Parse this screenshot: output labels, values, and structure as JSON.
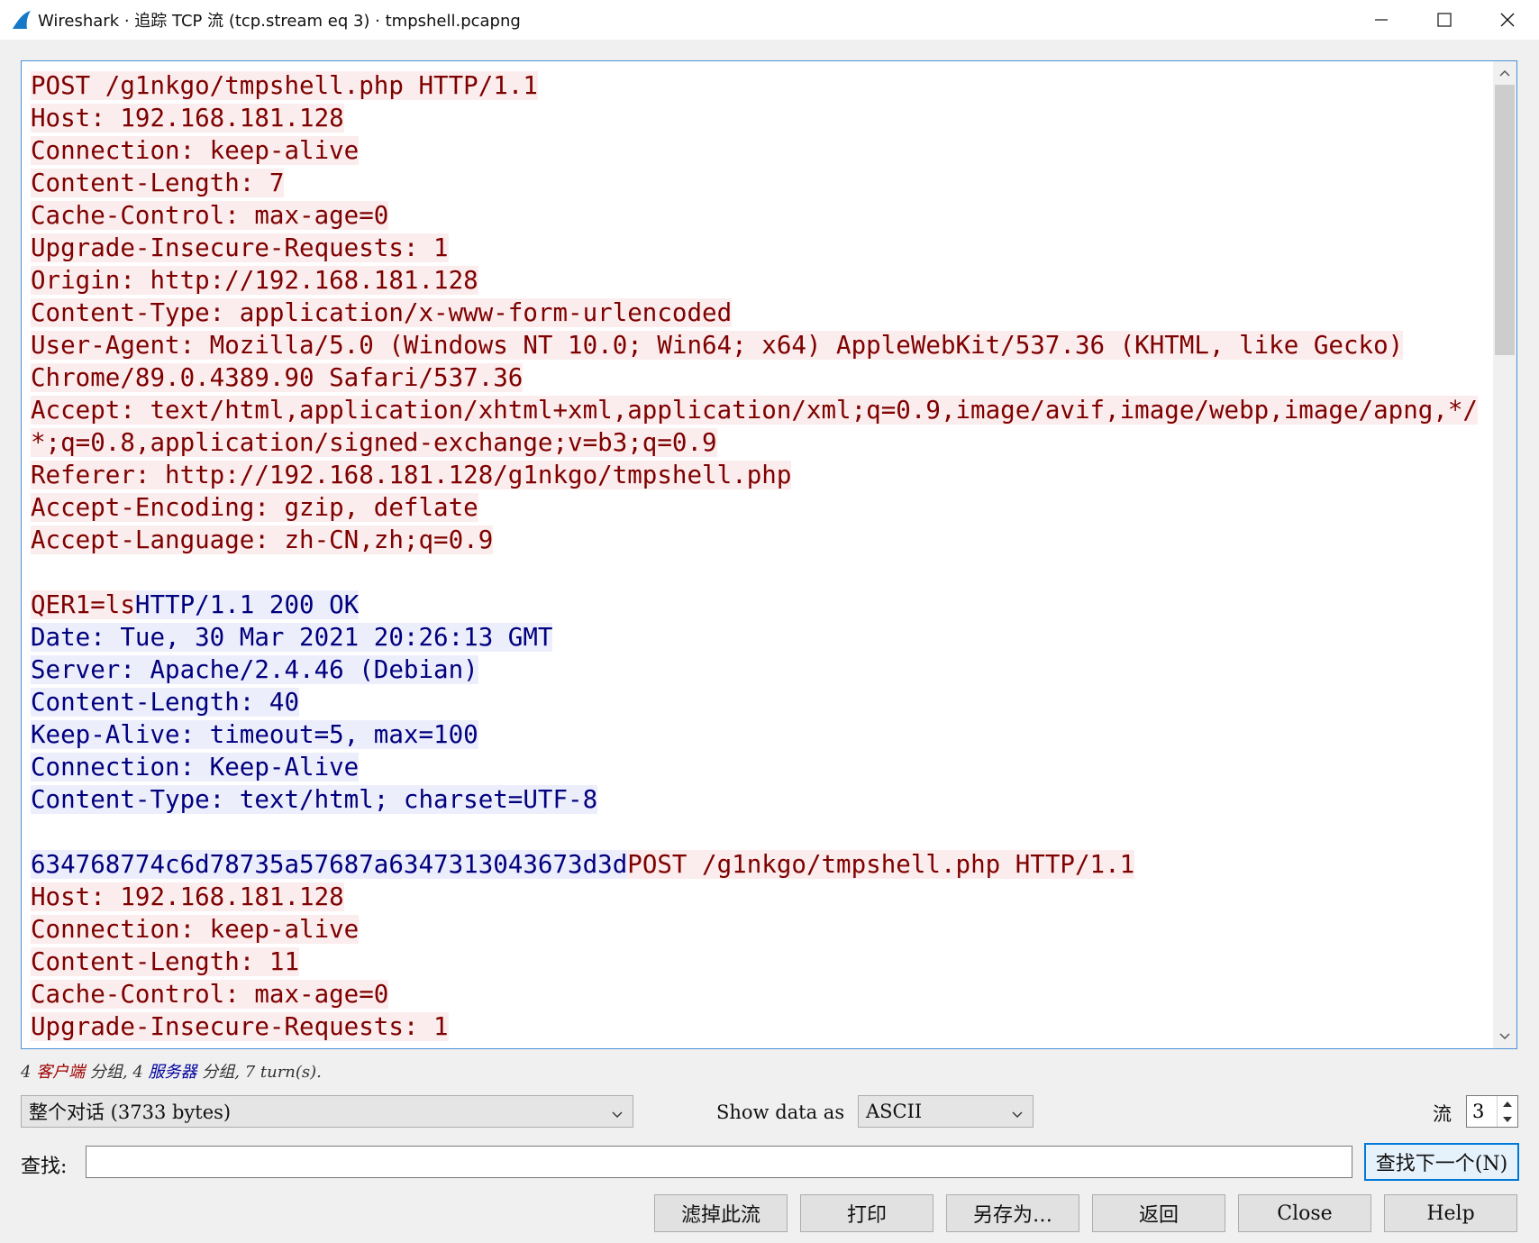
{
  "window": {
    "title": "Wireshark · 追踪 TCP 流 (tcp.stream eq 3) · tmpshell.pcapng",
    "icons": [
      "wireshark-fin-icon",
      "minimize-icon",
      "maximize-icon",
      "close-icon"
    ]
  },
  "colors": {
    "client_bg": "#fbeded",
    "client_fg": "#7f0000",
    "server_bg": "#edeefb",
    "server_fg": "#00007f",
    "accent": "#0078d7"
  },
  "stream": {
    "lines": [
      [
        {
          "t": "POST /g1nkgo/tmpshell.php HTTP/1.1",
          "k": "c"
        }
      ],
      [
        {
          "t": "Host: 192.168.181.128",
          "k": "c"
        }
      ],
      [
        {
          "t": "Connection: keep-alive",
          "k": "c"
        }
      ],
      [
        {
          "t": "Content-Length: 7",
          "k": "c"
        }
      ],
      [
        {
          "t": "Cache-Control: max-age=0",
          "k": "c"
        }
      ],
      [
        {
          "t": "Upgrade-Insecure-Requests: 1",
          "k": "c"
        }
      ],
      [
        {
          "t": "Origin: http://192.168.181.128",
          "k": "c"
        }
      ],
      [
        {
          "t": "Content-Type: application/x-www-form-urlencoded",
          "k": "c"
        }
      ],
      [
        {
          "t": "User-Agent: Mozilla/5.0 (Windows NT 10.0; Win64; x64) AppleWebKit/537.36 (KHTML, like Gecko)",
          "k": "c"
        }
      ],
      [
        {
          "t": "Chrome/89.0.4389.90 Safari/537.36",
          "k": "c"
        }
      ],
      [
        {
          "t": "Accept: text/html,application/xhtml+xml,application/xml;q=0.9,image/avif,image/webp,image/apng,*/",
          "k": "c"
        }
      ],
      [
        {
          "t": "*;q=0.8,application/signed-exchange;v=b3;q=0.9",
          "k": "c"
        }
      ],
      [
        {
          "t": "Referer: http://192.168.181.128/g1nkgo/tmpshell.php",
          "k": "c"
        }
      ],
      [
        {
          "t": "Accept-Encoding: gzip, deflate",
          "k": "c"
        }
      ],
      [
        {
          "t": "Accept-Language: zh-CN,zh;q=0.9",
          "k": "c"
        }
      ],
      [],
      [
        {
          "t": "QER1=ls",
          "k": "c"
        },
        {
          "t": "HTTP/1.1 200 OK",
          "k": "s"
        }
      ],
      [
        {
          "t": "Date: Tue, 30 Mar 2021 20:26:13 GMT",
          "k": "s"
        }
      ],
      [
        {
          "t": "Server: Apache/2.4.46 (Debian)",
          "k": "s"
        }
      ],
      [
        {
          "t": "Content-Length: 40",
          "k": "s"
        }
      ],
      [
        {
          "t": "Keep-Alive: timeout=5, max=100",
          "k": "s"
        }
      ],
      [
        {
          "t": "Connection: Keep-Alive",
          "k": "s"
        }
      ],
      [
        {
          "t": "Content-Type: text/html; charset=UTF-8",
          "k": "s"
        }
      ],
      [],
      [
        {
          "t": "634768774c6d78735a57687a6347313043673d3d",
          "k": "s"
        },
        {
          "t": "POST /g1nkgo/tmpshell.php HTTP/1.1",
          "k": "c"
        }
      ],
      [
        {
          "t": "Host: 192.168.181.128",
          "k": "c"
        }
      ],
      [
        {
          "t": "Connection: keep-alive",
          "k": "c"
        }
      ],
      [
        {
          "t": "Content-Length: 11",
          "k": "c"
        }
      ],
      [
        {
          "t": "Cache-Control: max-age=0",
          "k": "c"
        }
      ],
      [
        {
          "t": "Upgrade-Insecure-Requests: 1",
          "k": "c"
        }
      ]
    ]
  },
  "summary": {
    "prefix": "4 ",
    "client": "客户端",
    "mid": " 分组, 4 ",
    "server": "服务器",
    "suffix": " 分组, 7 turn(s)."
  },
  "controls": {
    "conversation_select": "整个对话 (3733 bytes)",
    "show_data_label": "Show data as",
    "show_data_select": "ASCII",
    "stream_label": "流",
    "stream_value": "3",
    "find_label": "查找:",
    "find_value": "",
    "find_next_button": "查找下一个(N)"
  },
  "buttons": {
    "filter_out": "滤掉此流",
    "print": "打印",
    "save_as": "另存为…",
    "back": "返回",
    "close": "Close",
    "help": "Help"
  }
}
